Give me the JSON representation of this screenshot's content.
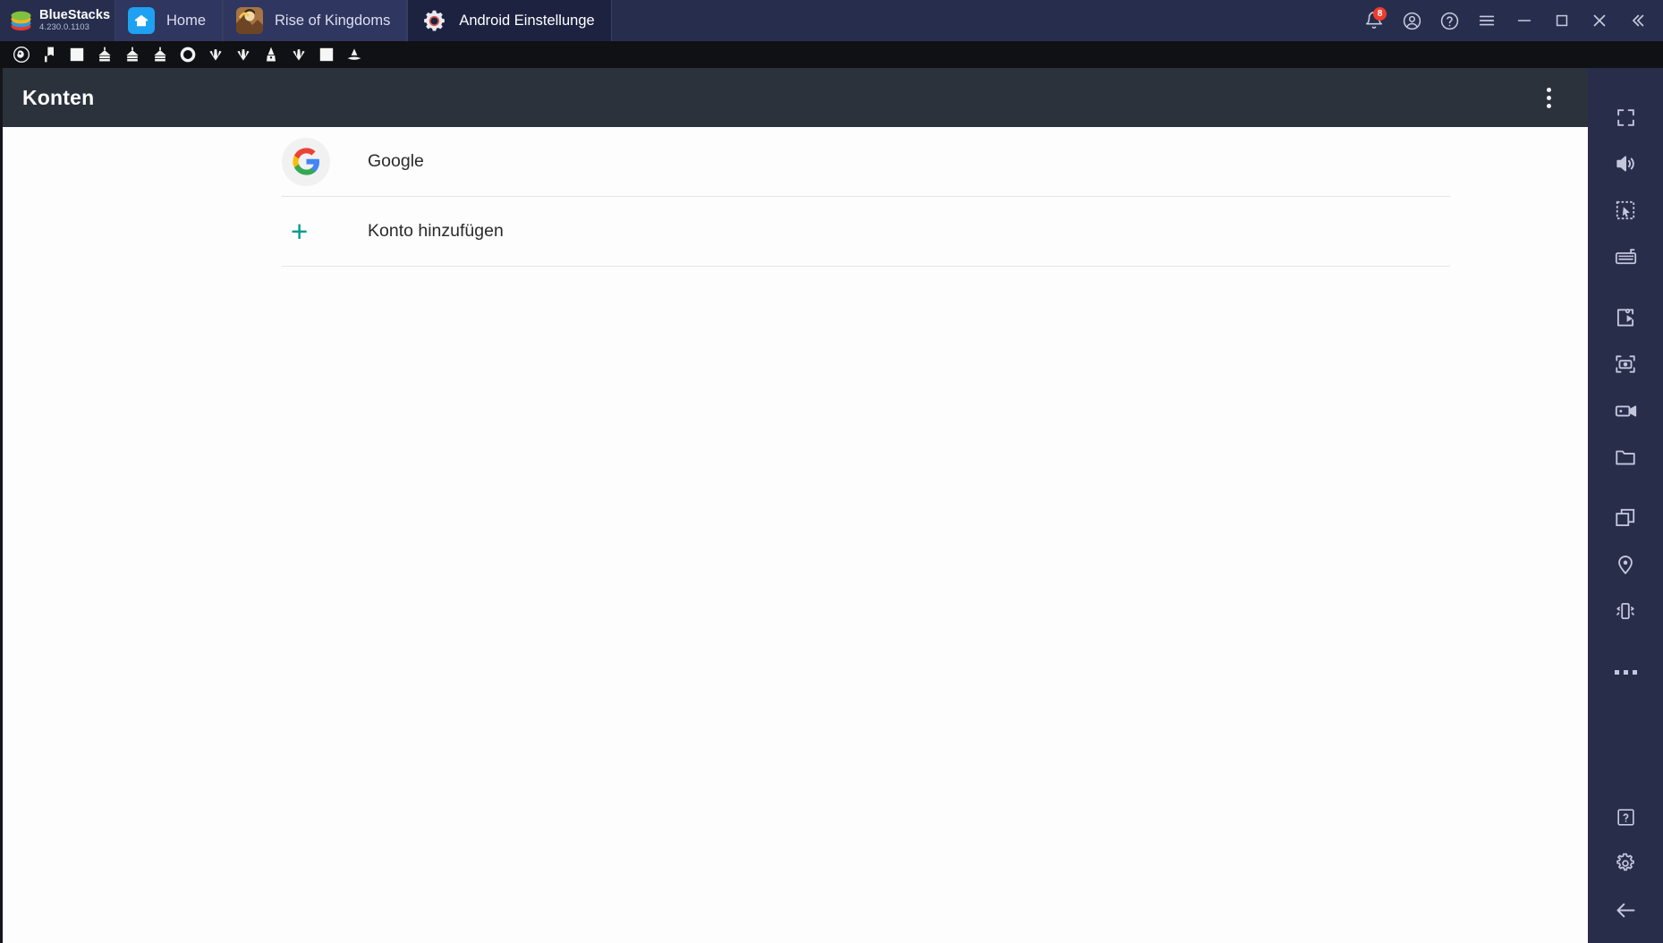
{
  "window": {
    "brand_name": "BlueStacks",
    "brand_version": "4.230.0.1103",
    "tabs": [
      {
        "id": "home",
        "label": "Home",
        "icon": "home-icon",
        "active": false
      },
      {
        "id": "rise-of-kingdoms",
        "label": "Rise of Kingdoms",
        "icon": "game-avatar-icon",
        "active": false
      },
      {
        "id": "android-settings",
        "label": "Android Einstellunge",
        "icon": "gear-icon",
        "active": true
      }
    ],
    "controls": [
      {
        "id": "notifications",
        "icon": "bell-icon",
        "badge": "8"
      },
      {
        "id": "account",
        "icon": "account-circle-icon",
        "badge": ""
      },
      {
        "id": "help",
        "icon": "help-circle-icon",
        "badge": ""
      },
      {
        "id": "menu",
        "icon": "hamburger-menu-icon",
        "badge": ""
      },
      {
        "id": "minimize",
        "icon": "minimize-icon",
        "badge": ""
      },
      {
        "id": "maximize",
        "icon": "maximize-icon",
        "badge": ""
      },
      {
        "id": "close",
        "icon": "close-icon",
        "badge": ""
      },
      {
        "id": "collapse",
        "icon": "double-chevron-left-icon",
        "badge": ""
      }
    ]
  },
  "shortcut_bar": {
    "items": [
      {
        "id": "sc1",
        "icon": "helmet-shortcut-icon"
      },
      {
        "id": "sc2",
        "icon": "banner-shortcut-icon"
      },
      {
        "id": "sc3",
        "icon": "square-shortcut-icon"
      },
      {
        "id": "sc4",
        "icon": "building-shortcut-icon"
      },
      {
        "id": "sc5",
        "icon": "building-shortcut-icon"
      },
      {
        "id": "sc6",
        "icon": "building-shortcut-icon"
      },
      {
        "id": "sc7",
        "icon": "ring-shortcut-icon"
      },
      {
        "id": "sc8",
        "icon": "burst-shortcut-icon"
      },
      {
        "id": "sc9",
        "icon": "burst-shortcut-icon"
      },
      {
        "id": "sc10",
        "icon": "tower-shortcut-icon"
      },
      {
        "id": "sc11",
        "icon": "burst-shortcut-icon"
      },
      {
        "id": "sc12",
        "icon": "square-shortcut-icon"
      },
      {
        "id": "sc13",
        "icon": "bird-shortcut-icon"
      }
    ]
  },
  "android": {
    "app_bar": {
      "title": "Konten",
      "overflow_icon": "more-vert-icon"
    },
    "accounts": [
      {
        "id": "google",
        "label": "Google",
        "icon": "google-g-icon"
      }
    ],
    "add_account": {
      "label": "Konto hinzufügen",
      "icon": "plus-icon",
      "accent_color": "#00998a"
    }
  },
  "sidebar": {
    "items": [
      {
        "id": "fullscreen",
        "icon": "fullscreen-icon"
      },
      {
        "id": "volume",
        "icon": "volume-icon"
      },
      {
        "id": "multi-select",
        "icon": "select-cursor-icon"
      },
      {
        "id": "keyboard-controls",
        "icon": "keyboard-icon"
      },
      {
        "id": "macro-play",
        "icon": "script-play-icon"
      },
      {
        "id": "screenshot",
        "icon": "camera-icon"
      },
      {
        "id": "record",
        "icon": "video-camera-icon"
      },
      {
        "id": "media-folder",
        "icon": "folder-icon"
      },
      {
        "id": "multi-instance",
        "icon": "copy-windows-icon"
      },
      {
        "id": "location",
        "icon": "location-pin-icon"
      },
      {
        "id": "shake",
        "icon": "shake-device-icon"
      },
      {
        "id": "more",
        "icon": "more-horizontal-icon"
      },
      {
        "id": "help",
        "icon": "help-square-icon"
      },
      {
        "id": "settings",
        "icon": "gear-icon"
      },
      {
        "id": "back",
        "icon": "arrow-left-icon"
      }
    ]
  },
  "colors": {
    "titlebar_bg": "#272e4d",
    "tab_active_bg": "#1d2240",
    "shortcut_bar_bg": "#101114",
    "app_bar_bg": "#2b323c",
    "sidebar_bg": "#282d4a",
    "accent_teal": "#00998a",
    "badge_red": "#ef3b2d"
  }
}
